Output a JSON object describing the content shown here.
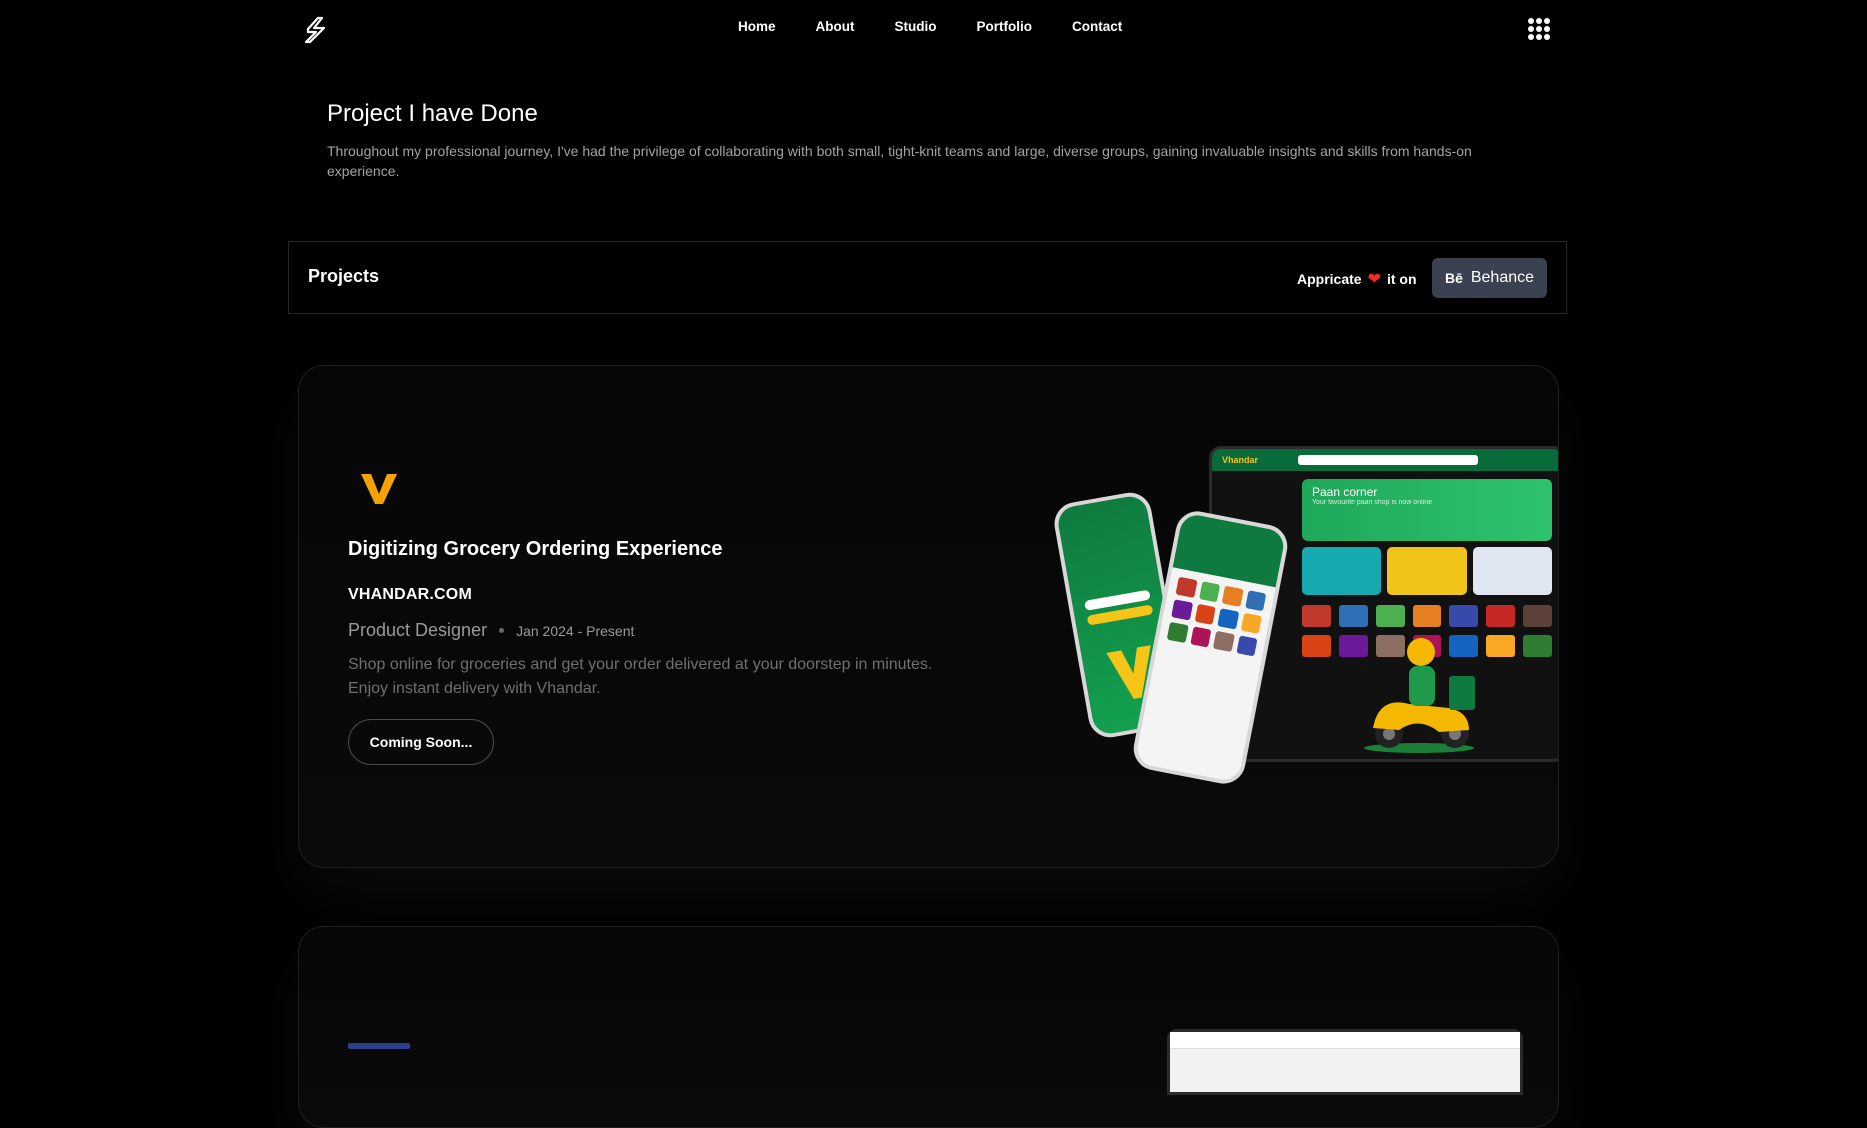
{
  "nav": {
    "links": [
      "Home",
      "About",
      "Studio",
      "Portfolio",
      "Contact"
    ]
  },
  "intro": {
    "title": "Project I have Done",
    "text": "Throughout my professional journey, I've had the privilege of collaborating with both small, tight-knit teams and large, diverse groups, gaining invaluable insights and skills from hands-on experience."
  },
  "projects_bar": {
    "label": "Projects",
    "appreciate_prefix": "Appricate",
    "appreciate_suffix": "it on",
    "behance_icon": "Bē",
    "behance_label": "Behance"
  },
  "project": {
    "title": "Digitizing Grocery Ordering Experience",
    "company": "VHANDAR.COM",
    "role": "Product Designer",
    "date": "Jan 2024 - Present",
    "description": "Shop online for groceries and get your order delivered at your doorstep in minutes. Enjoy instant delivery with Vhandar.",
    "button": "Coming Soon...",
    "mockup": {
      "brand": "Vhandar",
      "banner_title": "Paan corner",
      "banner_sub": "Your favourite paan shop is now online"
    }
  },
  "colors": {
    "accent_orange": "#f5a300",
    "brand_green": "#0f7a3f",
    "heart": "#ef2b2b",
    "behance_bg": "#3a4150"
  }
}
